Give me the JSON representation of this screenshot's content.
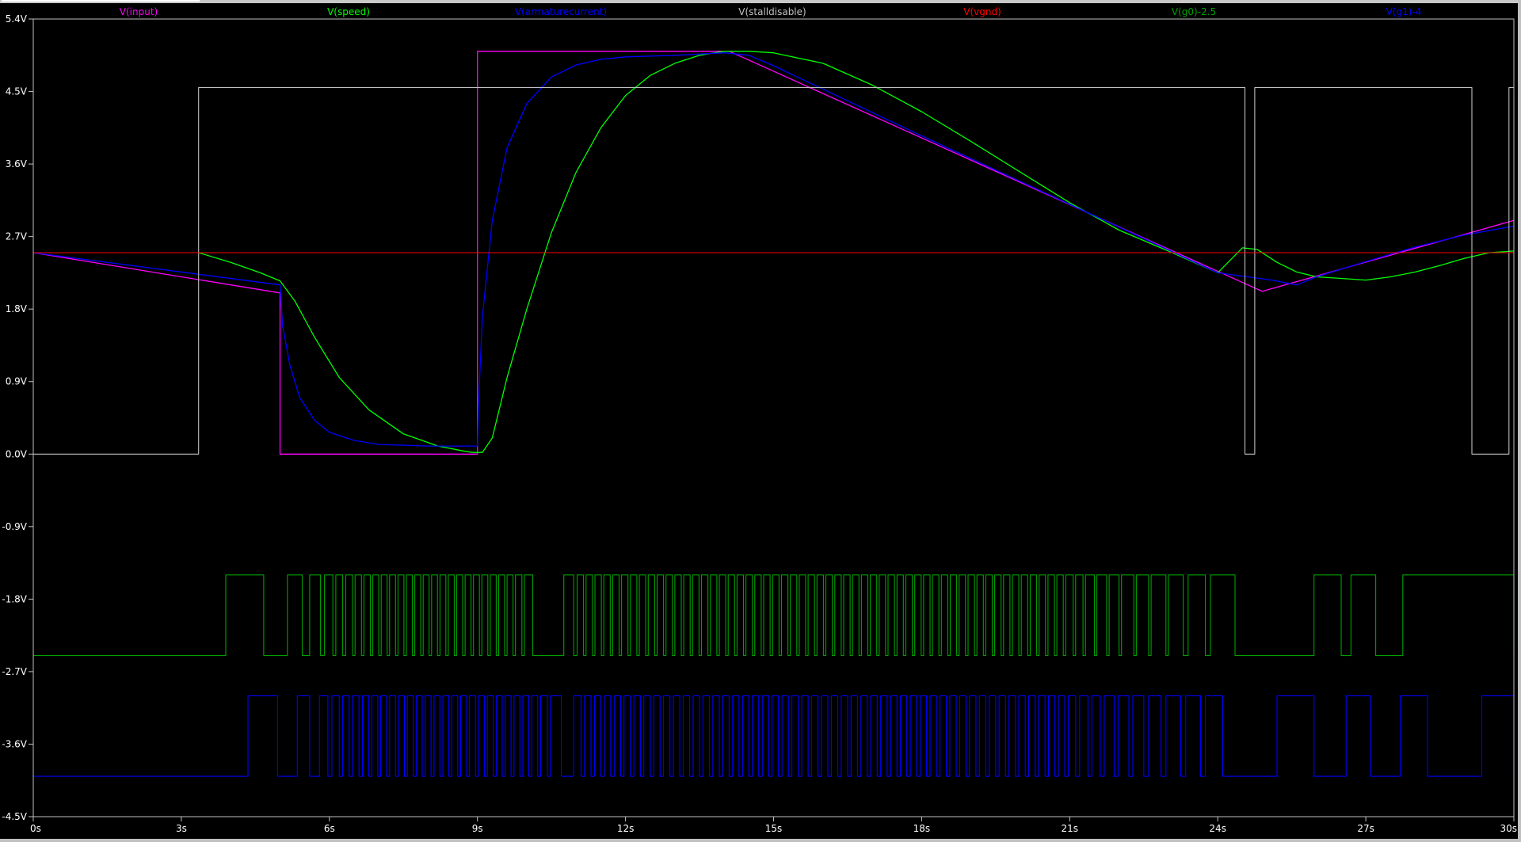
{
  "chart_data": {
    "type": "line",
    "title": "",
    "xlabel": "",
    "ylabel": "",
    "xlim": [
      0,
      30
    ],
    "ylim": [
      -4.5,
      5.4
    ],
    "xticks": [
      0,
      3,
      6,
      9,
      12,
      15,
      18,
      21,
      24,
      27,
      30
    ],
    "xtick_labels": [
      "0s",
      "3s",
      "6s",
      "9s",
      "12s",
      "15s",
      "18s",
      "21s",
      "24s",
      "27s",
      "30s"
    ],
    "yticks": [
      5.4,
      4.5,
      3.6,
      2.7,
      1.8,
      0.9,
      0.0,
      -0.9,
      -1.8,
      -2.7,
      -3.6,
      -4.5
    ],
    "ytick_labels": [
      "5.4V",
      "4.5V",
      "3.6V",
      "2.7V",
      "1.8V",
      "0.9V",
      "0.0V",
      "-0.9V",
      "-1.8V",
      "-2.7V",
      "-3.6V",
      "-4.5V"
    ],
    "grid": false,
    "legend": "top",
    "colors": {
      "background": "#000000",
      "axes": "#c0c0c0",
      "tick_text": "#ffffff"
    },
    "series": [
      {
        "name": "V(input)",
        "color": "#ff00ff",
        "width": 1.3,
        "x": [
          0,
          5.0,
          5.0,
          9.0,
          9.0,
          14.1,
          24.9,
          30
        ],
        "y": [
          2.5,
          2.0,
          0.0,
          0.0,
          5.0,
          5.0,
          2.02,
          2.9
        ]
      },
      {
        "name": "V(speed)",
        "color": "#00ff00",
        "width": 1.3,
        "x": [
          3.35,
          4.0,
          4.6,
          5.0,
          5.3,
          5.7,
          6.2,
          6.8,
          7.5,
          8.2,
          8.7,
          8.9,
          9.1,
          9.3,
          9.6,
          10.0,
          10.5,
          11.0,
          11.5,
          12.0,
          12.5,
          13.0,
          13.5,
          14.0,
          14.5,
          15.0,
          16.0,
          17.0,
          18.0,
          19.0,
          20.0,
          21.0,
          22.0,
          23.0,
          24.0,
          24.5,
          24.8,
          25.2,
          25.6,
          26.0,
          26.5,
          27.0,
          27.5,
          28.0,
          28.5,
          29.0,
          29.5,
          30.0
        ],
        "y": [
          2.5,
          2.38,
          2.25,
          2.15,
          1.9,
          1.45,
          0.95,
          0.55,
          0.25,
          0.1,
          0.04,
          0.02,
          0.02,
          0.2,
          0.95,
          1.8,
          2.75,
          3.5,
          4.05,
          4.45,
          4.7,
          4.85,
          4.95,
          5.0,
          5.0,
          4.98,
          4.85,
          4.58,
          4.25,
          3.88,
          3.5,
          3.12,
          2.78,
          2.52,
          2.25,
          2.56,
          2.54,
          2.38,
          2.26,
          2.2,
          2.18,
          2.16,
          2.2,
          2.26,
          2.34,
          2.43,
          2.5,
          2.52
        ]
      },
      {
        "name": "V(armaturecurrent)",
        "color": "#0000ff",
        "width": 1.3,
        "x": [
          0,
          5.0,
          5.05,
          5.2,
          5.4,
          5.7,
          6.0,
          6.5,
          7.0,
          8.0,
          9.0,
          9.02,
          9.1,
          9.3,
          9.6,
          10.0,
          10.5,
          11.0,
          11.5,
          12.0,
          12.5,
          13.0,
          14.0,
          14.5,
          15.0,
          18.0,
          21.0,
          24.0,
          25.1,
          25.6,
          26.0,
          27.0,
          28.0,
          29.0,
          30.0
        ],
        "y": [
          2.5,
          2.1,
          1.6,
          1.1,
          0.7,
          0.42,
          0.27,
          0.17,
          0.12,
          0.1,
          0.1,
          0.6,
          1.7,
          2.9,
          3.8,
          4.35,
          4.68,
          4.83,
          4.9,
          4.93,
          4.94,
          4.95,
          4.98,
          4.95,
          4.82,
          3.95,
          3.1,
          2.25,
          2.16,
          2.1,
          2.2,
          2.39,
          2.57,
          2.72,
          2.83
        ]
      },
      {
        "name": "V(stalldisable)",
        "color": "#c0c0c0",
        "width": 1.1,
        "x": [
          0,
          3.35,
          3.35,
          24.55,
          24.55,
          24.75,
          24.75,
          29.15,
          29.15,
          29.9,
          29.9,
          30.0
        ],
        "y": [
          0,
          0,
          4.55,
          4.55,
          0,
          0,
          4.55,
          4.55,
          0,
          0,
          4.55,
          4.55
        ]
      },
      {
        "name": "V(vgnd)",
        "color": "#ff0000",
        "width": 1.1,
        "x": [
          0,
          30
        ],
        "y": [
          2.5,
          2.5
        ]
      },
      {
        "name": "V(g0)-2.5",
        "color": "#00a000",
        "width": 1.1,
        "pwm": true,
        "lo": -2.5,
        "hi": -1.5,
        "edges": [
          3.9,
          4.67,
          5.15,
          5.45,
          5.6,
          5.82,
          5.9,
          6.07,
          6.13,
          6.27,
          6.33,
          6.47,
          6.52,
          6.65,
          6.7,
          6.83,
          6.88,
          7.0,
          7.05,
          7.17,
          7.22,
          7.34,
          7.39,
          7.51,
          7.56,
          7.68,
          7.73,
          7.85,
          7.9,
          8.02,
          8.07,
          8.19,
          8.24,
          8.36,
          8.41,
          8.53,
          8.58,
          8.7,
          8.75,
          8.87,
          8.92,
          9.04,
          9.09,
          9.21,
          9.26,
          9.38,
          9.43,
          9.55,
          9.6,
          9.72,
          9.77,
          9.9,
          9.95,
          10.12,
          10.75,
          10.95,
          11.02,
          11.15,
          11.2,
          11.33,
          11.38,
          11.51,
          11.56,
          11.69,
          11.74,
          11.87,
          11.92,
          12.05,
          12.1,
          12.23,
          12.28,
          12.41,
          12.46,
          12.59,
          12.64,
          12.77,
          12.82,
          12.95,
          13.0,
          13.13,
          13.18,
          13.31,
          13.36,
          13.49,
          13.54,
          13.67,
          13.72,
          13.85,
          13.9,
          14.03,
          14.08,
          14.21,
          14.26,
          14.39,
          14.44,
          14.57,
          14.62,
          14.75,
          14.8,
          14.93,
          14.98,
          15.11,
          15.16,
          15.29,
          15.34,
          15.47,
          15.52,
          15.65,
          15.7,
          15.83,
          15.88,
          16.01,
          16.06,
          16.19,
          16.24,
          16.37,
          16.42,
          16.55,
          16.6,
          16.73,
          16.78,
          16.91,
          16.96,
          17.09,
          17.14,
          17.27,
          17.32,
          17.45,
          17.5,
          17.63,
          17.68,
          17.81,
          17.86,
          17.99,
          18.04,
          18.17,
          18.22,
          18.35,
          18.4,
          18.53,
          18.58,
          18.71,
          18.76,
          18.89,
          18.94,
          19.07,
          19.12,
          19.25,
          19.3,
          19.43,
          19.48,
          19.61,
          19.66,
          19.79,
          19.84,
          19.97,
          20.02,
          20.15,
          20.2,
          20.33,
          20.38,
          20.51,
          20.56,
          20.69,
          20.74,
          20.87,
          20.92,
          21.07,
          21.12,
          21.27,
          21.32,
          21.5,
          21.55,
          21.75,
          21.8,
          22.0,
          22.05,
          22.3,
          22.35,
          22.6,
          22.65,
          22.95,
          23.0,
          23.3,
          23.4,
          23.75,
          23.85,
          24.35,
          25.95,
          26.5,
          26.7,
          27.2,
          27.75,
          30.0
        ]
      },
      {
        "name": "V(g1)-4",
        "color": "#0000ff",
        "width": 1.1,
        "pwm": true,
        "lo": -4.0,
        "hi": -3.0,
        "edges": [
          4.35,
          4.95,
          5.35,
          5.6,
          5.8,
          5.97,
          6.05,
          6.2,
          6.27,
          6.4,
          6.47,
          6.6,
          6.67,
          6.8,
          6.86,
          6.98,
          7.04,
          7.16,
          7.22,
          7.34,
          7.4,
          7.52,
          7.58,
          7.7,
          7.76,
          7.88,
          7.94,
          8.06,
          8.12,
          8.24,
          8.3,
          8.42,
          8.48,
          8.6,
          8.66,
          8.78,
          8.84,
          8.96,
          9.02,
          9.14,
          9.2,
          9.32,
          9.38,
          9.5,
          9.56,
          9.68,
          9.74,
          9.86,
          9.92,
          10.04,
          10.1,
          10.22,
          10.28,
          10.42,
          10.48,
          10.7,
          10.95,
          11.1,
          11.17,
          11.3,
          11.37,
          11.5,
          11.57,
          11.7,
          11.77,
          11.9,
          11.97,
          12.1,
          12.17,
          12.3,
          12.37,
          12.5,
          12.57,
          12.7,
          12.77,
          12.9,
          12.97,
          13.1,
          13.17,
          13.3,
          13.37,
          13.5,
          13.57,
          13.7,
          13.77,
          13.9,
          13.97,
          14.1,
          14.17,
          14.3,
          14.37,
          14.5,
          14.57,
          14.7,
          14.77,
          14.9,
          14.97,
          15.1,
          15.17,
          15.3,
          15.37,
          15.5,
          15.57,
          15.7,
          15.77,
          15.9,
          15.97,
          16.1,
          16.17,
          16.3,
          16.37,
          16.5,
          16.57,
          16.7,
          16.77,
          16.9,
          16.97,
          17.1,
          17.17,
          17.3,
          17.37,
          17.5,
          17.57,
          17.7,
          17.77,
          17.9,
          17.97,
          18.1,
          18.17,
          18.3,
          18.37,
          18.5,
          18.57,
          18.7,
          18.77,
          18.9,
          18.97,
          19.1,
          19.17,
          19.3,
          19.37,
          19.5,
          19.57,
          19.7,
          19.77,
          19.9,
          19.97,
          20.1,
          20.17,
          20.3,
          20.37,
          20.5,
          20.57,
          20.7,
          20.77,
          20.9,
          20.97,
          21.12,
          21.2,
          21.37,
          21.45,
          21.62,
          21.7,
          21.9,
          21.98,
          22.2,
          22.28,
          22.5,
          22.6,
          22.85,
          22.95,
          23.25,
          23.35,
          23.65,
          23.75,
          24.1,
          25.2,
          25.95,
          26.6,
          27.1,
          27.7,
          28.25,
          29.35,
          30.0
        ]
      }
    ]
  }
}
